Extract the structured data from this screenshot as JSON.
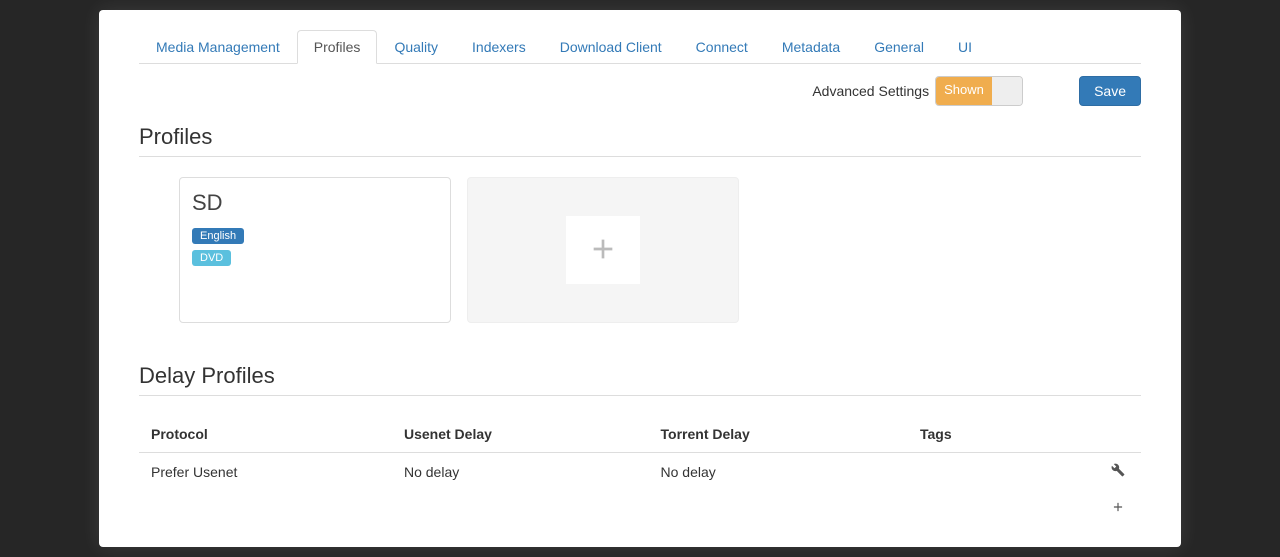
{
  "tabs": [
    {
      "label": "Media Management",
      "active": false
    },
    {
      "label": "Profiles",
      "active": true
    },
    {
      "label": "Quality",
      "active": false
    },
    {
      "label": "Indexers",
      "active": false
    },
    {
      "label": "Download Client",
      "active": false
    },
    {
      "label": "Connect",
      "active": false
    },
    {
      "label": "Metadata",
      "active": false
    },
    {
      "label": "General",
      "active": false
    },
    {
      "label": "UI",
      "active": false
    }
  ],
  "advanced": {
    "label": "Advanced Settings",
    "state": "Shown"
  },
  "save_label": "Save",
  "sections": {
    "profiles_title": "Profiles",
    "delay_title": "Delay Profiles"
  },
  "profile_card": {
    "name": "SD",
    "language_badge": "English",
    "quality_badge": "DVD"
  },
  "delay_table": {
    "headers": {
      "protocol": "Protocol",
      "usenet": "Usenet Delay",
      "torrent": "Torrent Delay",
      "tags": "Tags"
    },
    "row": {
      "protocol": "Prefer Usenet",
      "usenet": "No delay",
      "torrent": "No delay",
      "tags": ""
    }
  }
}
